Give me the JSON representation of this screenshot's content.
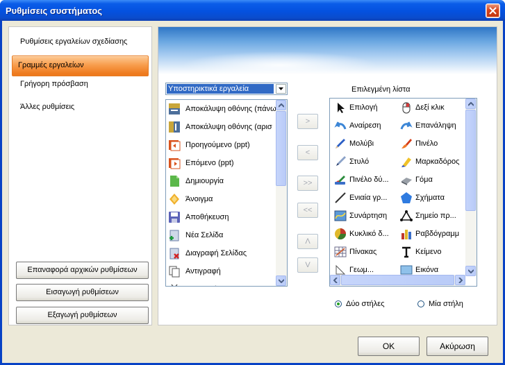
{
  "window": {
    "title": "Ρυθμίσεις συστήματος"
  },
  "sidebar": {
    "items": [
      {
        "label": "Ρυθμίσεις εργαλείων σχεδίασης",
        "selected": false
      },
      {
        "label": "Γραμμές εργαλείων",
        "selected": true
      },
      {
        "label": "Γρήγορη πρόσβαση",
        "selected": false
      },
      {
        "label": "Άλλες ρυθμίσεις",
        "selected": false
      }
    ],
    "buttons": {
      "reset": "Επαναφορά αρχικών ρυθμίσεων",
      "import": "Εισαγωγή ρυθμίσεων",
      "export": "Εξαγωγή ρυθμίσεων"
    }
  },
  "available": {
    "dropdown_value": "Υποστηρικτικά εργαλεία",
    "items": [
      {
        "label": "Αποκάλυψη οθόνης (πάνω",
        "icon": "screen-reveal-top-icon"
      },
      {
        "label": "Αποκάλυψη οθόνης (αρισ",
        "icon": "screen-reveal-left-icon"
      },
      {
        "label": "Προηγούμενο (ppt)",
        "icon": "ppt-previous-icon"
      },
      {
        "label": "Επόμενο (ppt)",
        "icon": "ppt-next-icon"
      },
      {
        "label": "Δημιουργία",
        "icon": "new-file-icon"
      },
      {
        "label": "Άνοιγμα",
        "icon": "open-folder-icon"
      },
      {
        "label": "Αποθήκευση",
        "icon": "save-disk-icon"
      },
      {
        "label": "Νέα Σελίδα",
        "icon": "new-page-icon"
      },
      {
        "label": "Διαγραφή Σελίδας",
        "icon": "delete-page-icon"
      },
      {
        "label": "Αντιγραφή",
        "icon": "copy-icon"
      },
      {
        "label": "Αποκοπή",
        "icon": "cut-icon"
      }
    ]
  },
  "move_buttons": {
    "add": ">",
    "remove": "<",
    "add_all": ">>",
    "remove_all": "<<",
    "up": "Λ",
    "down": "V"
  },
  "selected": {
    "caption": "Επιλεγμένη λίστα",
    "items": [
      {
        "label": "Επιλογή",
        "icon": "select-arrow-icon"
      },
      {
        "label": "Δεξί κλικ",
        "icon": "right-click-mouse-icon"
      },
      {
        "label": "Αναίρεση",
        "icon": "undo-icon"
      },
      {
        "label": "Επανάληψη",
        "icon": "redo-icon"
      },
      {
        "label": "Μολύβι",
        "icon": "pencil-icon"
      },
      {
        "label": "Πινέλο",
        "icon": "brush-icon"
      },
      {
        "label": "Στυλό",
        "icon": "pen-icon"
      },
      {
        "label": "Μαρκαδόρος",
        "icon": "marker-icon"
      },
      {
        "label": "Πινέλο δύ...",
        "icon": "brush-double-icon"
      },
      {
        "label": "Γόμα",
        "icon": "eraser-icon"
      },
      {
        "label": "Ενιαία γρ...",
        "icon": "line-icon"
      },
      {
        "label": "Σχήματα",
        "icon": "shapes-icon"
      },
      {
        "label": "Συνάρτηση",
        "icon": "function-graph-icon"
      },
      {
        "label": "Σημείο πρ...",
        "icon": "point-icon"
      },
      {
        "label": "Κυκλικό δ...",
        "icon": "pie-chart-icon"
      },
      {
        "label": "Ραβδόγραμμ",
        "icon": "bar-chart-icon"
      },
      {
        "label": "Πίνακας",
        "icon": "table-icon"
      },
      {
        "label": "Κείμενο",
        "icon": "text-icon"
      },
      {
        "label": "Γεωμ...",
        "icon": "geometry-icon"
      },
      {
        "label": "Εικόνα",
        "icon": "image-icon"
      }
    ]
  },
  "layout_options": {
    "two_columns": "Δύο στήλες",
    "one_column": "Μία στήλη",
    "selected": "two_columns"
  },
  "footer": {
    "ok": "OK",
    "cancel": "Ακύρωση"
  }
}
